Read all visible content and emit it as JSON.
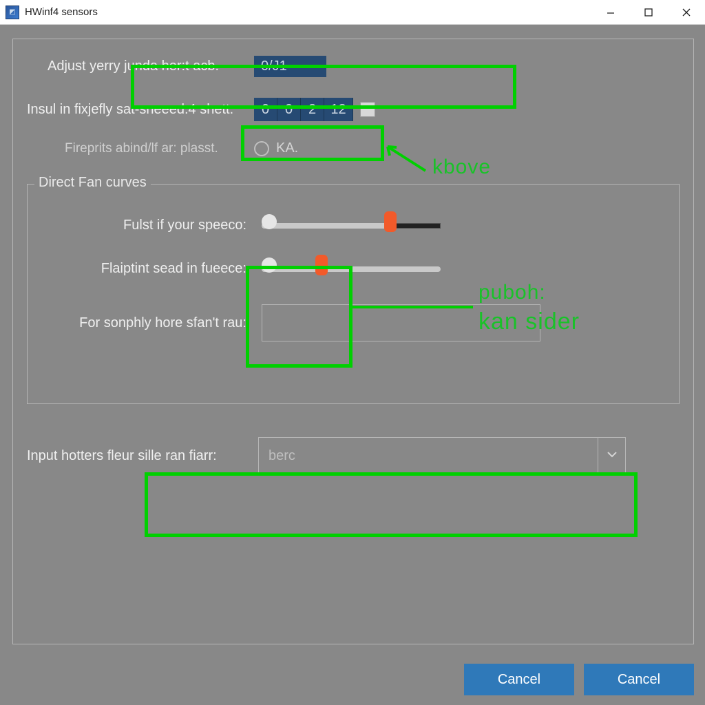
{
  "window": {
    "title": "HWinf4 sensors"
  },
  "form": {
    "row1": {
      "label": "Adjust yerry junda her:t acb.",
      "value": "0/J1"
    },
    "row2": {
      "label": "Insul in fixjefly sat-sneeed.4 shett.",
      "digits": [
        "0",
        "0",
        "2",
        "12"
      ]
    },
    "row3": {
      "label": "Fireprits abind/lf ar: plasst.",
      "radio_label": "KA."
    }
  },
  "fieldset": {
    "legend": "Direct Fan curves",
    "slider1_label": "Fulst if your speeco:",
    "slider2_label": "Flaiptint sead in fueece:",
    "input_label": "For sonphly hore sfan't rau:"
  },
  "combo": {
    "label": "Input hotters fleur sille ran fiarr:",
    "value": "berc"
  },
  "buttons": {
    "left": "Cancel",
    "right": "Cancel"
  },
  "annotations": {
    "a1": "kbove",
    "a2_line1": "puboh:",
    "a2_line2": "kan sider"
  }
}
